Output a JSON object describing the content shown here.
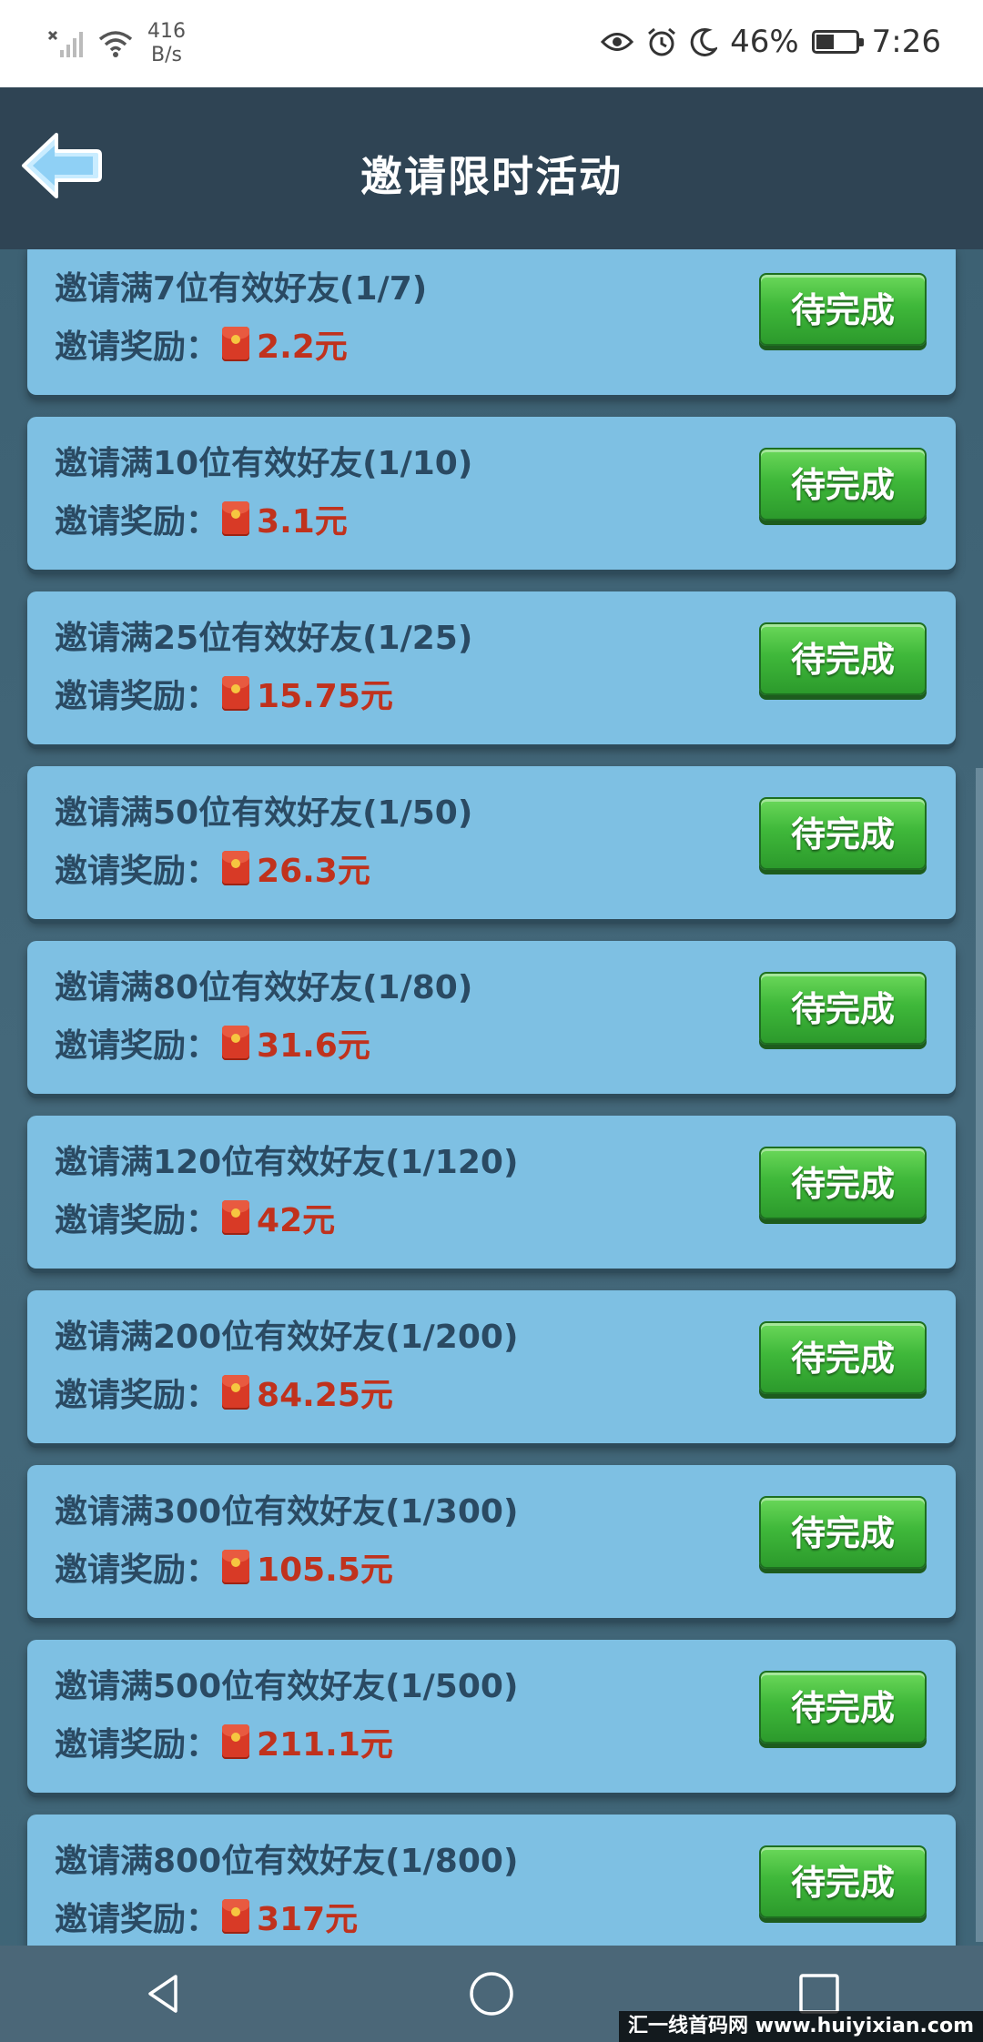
{
  "status_bar": {
    "net_speed_value": "416",
    "net_speed_unit": "B/s",
    "battery": "46%",
    "battery_level": 0.46,
    "time": "7:26"
  },
  "header": {
    "title": "邀请限时活动"
  },
  "reward_label": "邀请奖励：",
  "tasks": [
    {
      "title": "邀请满7位有效好友(1/7)",
      "amount": "2.2元",
      "button": "待完成"
    },
    {
      "title": "邀请满10位有效好友(1/10)",
      "amount": "3.1元",
      "button": "待完成"
    },
    {
      "title": "邀请满25位有效好友(1/25)",
      "amount": "15.75元",
      "button": "待完成"
    },
    {
      "title": "邀请满50位有效好友(1/50)",
      "amount": "26.3元",
      "button": "待完成"
    },
    {
      "title": "邀请满80位有效好友(1/80)",
      "amount": "31.6元",
      "button": "待完成"
    },
    {
      "title": "邀请满120位有效好友(1/120)",
      "amount": "42元",
      "button": "待完成"
    },
    {
      "title": "邀请满200位有效好友(1/200)",
      "amount": "84.25元",
      "button": "待完成"
    },
    {
      "title": "邀请满300位有效好友(1/300)",
      "amount": "105.5元",
      "button": "待完成"
    },
    {
      "title": "邀请满500位有效好友(1/500)",
      "amount": "211.1元",
      "button": "待完成"
    },
    {
      "title": "邀请满800位有效好友(1/800)",
      "amount": "317元",
      "button": "待完成"
    }
  ],
  "watermark": "汇一线首码网 www.huiyixian.com",
  "icons": {
    "signal": "signal-off-icon",
    "wifi": "wifi-icon",
    "eye": "eye-comfort-icon",
    "alarm": "alarm-icon",
    "moon": "do-not-disturb-icon",
    "battery": "battery-icon",
    "back": "back-arrow-icon",
    "reward": "red-packet-icon",
    "nav_back": "nav-back-icon",
    "nav_home": "nav-home-icon",
    "nav_recent": "nav-recent-icon"
  }
}
